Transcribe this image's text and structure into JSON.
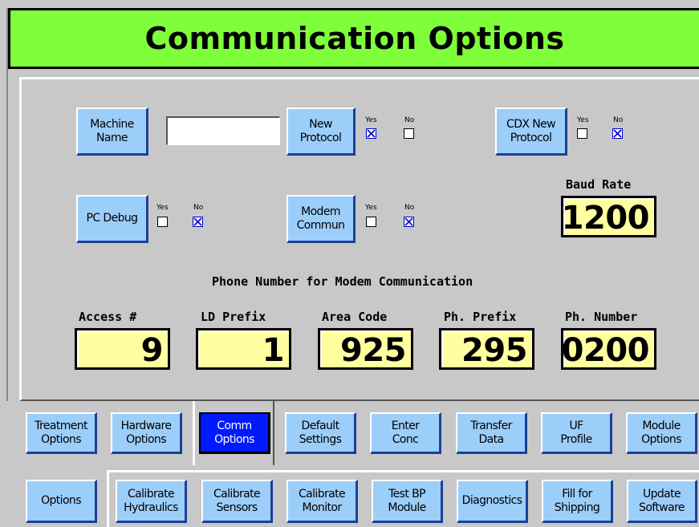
{
  "title": "Communication Options",
  "fields": {
    "machine_name": {
      "label": "Machine\nName",
      "value": ""
    },
    "new_protocol": {
      "label": "New\nProtocol",
      "yes": "Yes",
      "no": "No",
      "selected": "yes"
    },
    "cdx_new_protocol": {
      "label": "CDX New\nProtocol",
      "yes": "Yes",
      "no": "No",
      "selected": "no"
    },
    "pc_debug": {
      "label": "PC Debug",
      "yes": "Yes",
      "no": "No",
      "selected": "no"
    },
    "modem_commun": {
      "label": "Modem\nCommun",
      "yes": "Yes",
      "no": "No",
      "selected": "no"
    },
    "baud_rate": {
      "label": "Baud Rate",
      "value": "1200"
    }
  },
  "phone_heading": "Phone Number for Modem Communication",
  "phone": {
    "access": {
      "label": "Access #",
      "value": "9"
    },
    "ld_prefix": {
      "label": "LD Prefix",
      "value": "1"
    },
    "area_code": {
      "label": "Area Code",
      "value": "925"
    },
    "ph_prefix": {
      "label": "Ph. Prefix",
      "value": "295"
    },
    "ph_number": {
      "label": "Ph. Number",
      "value": "0200"
    }
  },
  "tabs": [
    {
      "label": "Treatment\nOptions",
      "active": false
    },
    {
      "label": "Hardware\nOptions",
      "active": false
    },
    {
      "label": "Comm\nOptions",
      "active": true
    },
    {
      "label": "Default\nSettings",
      "active": false
    },
    {
      "label": "Enter\nConc",
      "active": false
    },
    {
      "label": "Transfer\nData",
      "active": false
    },
    {
      "label": "UF\nProfile",
      "active": false
    },
    {
      "label": "Module\nOptions",
      "active": false
    }
  ],
  "subtabs": [
    {
      "label": "Options"
    },
    {
      "label": "Calibrate\nHydraulics"
    },
    {
      "label": "Calibrate\nSensors"
    },
    {
      "label": "Calibrate\nMonitor"
    },
    {
      "label": "Test BP\nModule"
    },
    {
      "label": "Diagnostics"
    },
    {
      "label": "Fill for\nShipping"
    },
    {
      "label": "Update\nSoftware"
    }
  ],
  "colors": {
    "title_bg": "#7fff3a",
    "button": "#9ccefa",
    "active_button": "#0019ff",
    "value_box": "#ffffa0",
    "background": "#c8c8c8"
  }
}
